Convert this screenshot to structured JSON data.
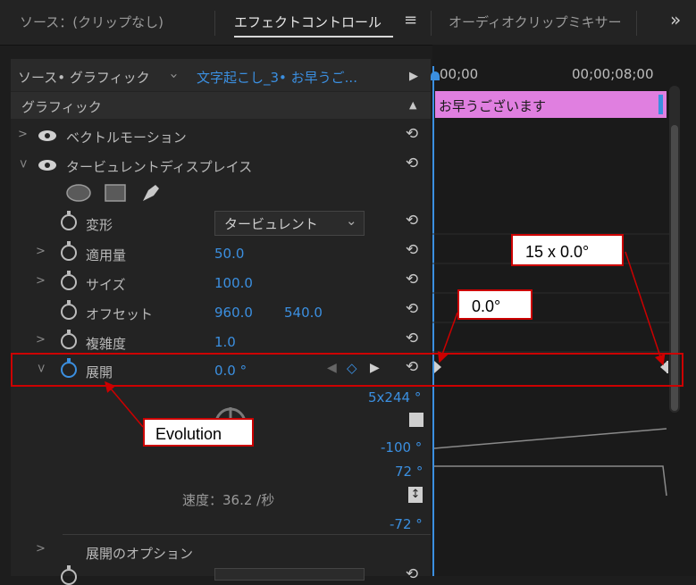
{
  "tabs": {
    "source": "ソース：(クリップなし)",
    "effect_controls": "エフェクトコントロール",
    "menu_icon": "≡",
    "audio_mixer": "オーディオクリップミキサー",
    "overflow": "»"
  },
  "source_bar": {
    "source_label": "ソース• グラフィック",
    "chevron": "›",
    "clip_label": "文字起こし_3• お早うご...",
    "play": "▶"
  },
  "timeline": {
    "time_start": "00;00",
    "time_end": "00;00;08;00",
    "clip_title": "お早うございます"
  },
  "section": {
    "title": "グラフィック",
    "collapse": "▲"
  },
  "effects": {
    "vector_motion": "ベクトルモーション",
    "turbulent_displace": "タービュレントディスプレイス"
  },
  "properties": {
    "deform_label": "変形",
    "deform_value": "タービュレント",
    "amount_label": "適用量",
    "amount_value": "50.0",
    "size_label": "サイズ",
    "size_value": "100.0",
    "offset_label": "オフセット",
    "offset_x": "960.0",
    "offset_y": "540.0",
    "complexity_label": "複雑度",
    "complexity_value": "1.0",
    "evolution_label": "展開",
    "evolution_value": "0.0 °"
  },
  "evolution_graph": {
    "top_value": "5x244 °",
    "mid_value": "-100 °",
    "upper_limit": "72 °",
    "lower_limit": "-72 °",
    "speed": "速度：36.2 /秒"
  },
  "evolution_options": "展開のオプション",
  "callouts": {
    "evolution": "Evolution",
    "start_value": "0.0°",
    "end_value": "15 x 0.0°"
  },
  "colors": {
    "accent_blue": "#3b8fe0",
    "clip_pink": "#e07fe0",
    "callout_red": "#cc0000"
  }
}
